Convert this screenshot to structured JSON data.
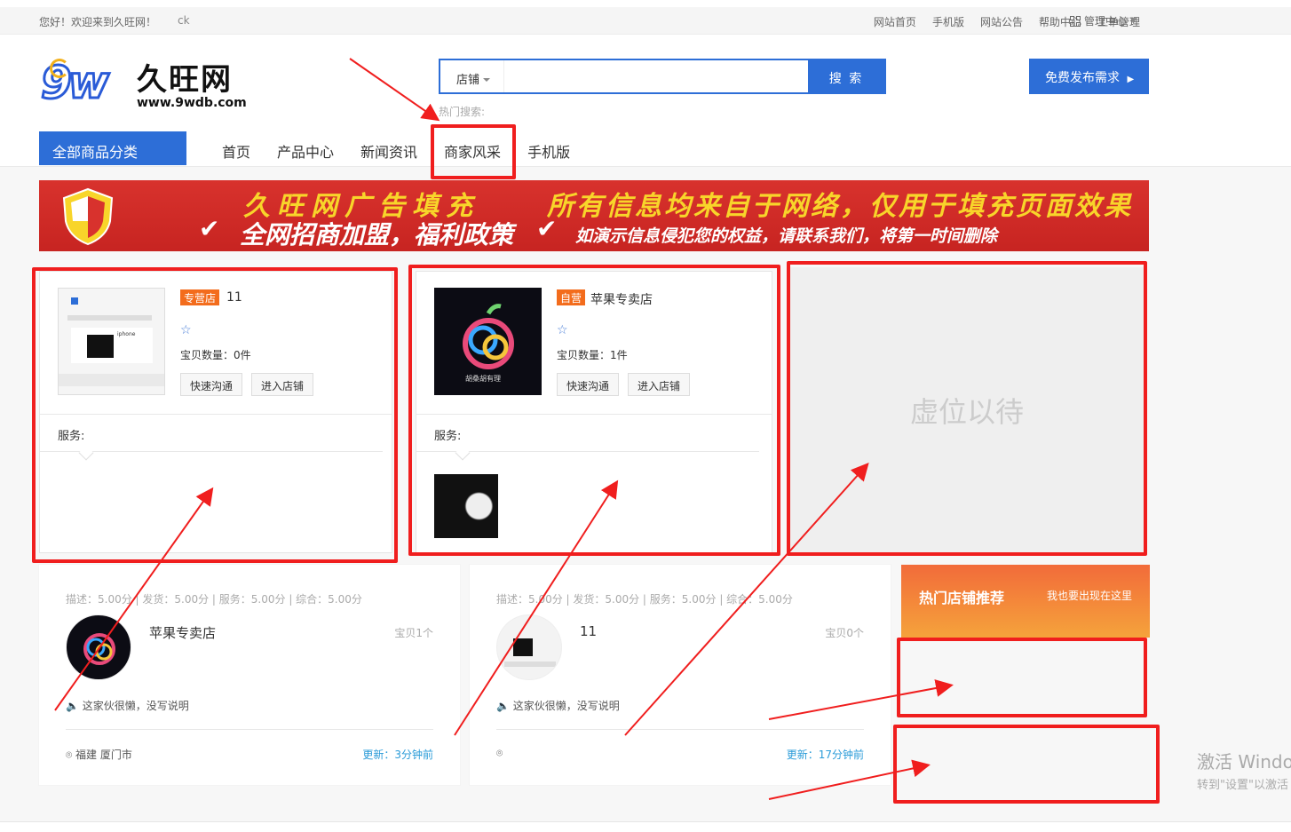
{
  "topbar": {
    "greeting": "您好！欢迎来到久旺网！",
    "username": "ck",
    "links": [
      "网站首页",
      "手机版",
      "网站公告",
      "帮助中心",
      "工单管理"
    ],
    "manage": "管理中心"
  },
  "logo": {
    "mark": "9w",
    "name": "久旺网",
    "url": "www.9wdb.com"
  },
  "search": {
    "type": "店铺",
    "placeholder": "",
    "button": "搜 索",
    "hot_label": "热门搜索:"
  },
  "publish_button": "免费发布需求",
  "nav": {
    "all_categories": "全部商品分类",
    "items": [
      "首页",
      "产品中心",
      "新闻资讯",
      "商家风采",
      "手机版"
    ]
  },
  "banner": {
    "line1": "久旺网广告填充",
    "line2": "全网招商加盟，福利政策",
    "line3": "所有信息均来自于网络，仅用于填充页面效果",
    "line4": "如演示信息侵犯您的权益，请联系我们，将第一时间删除"
  },
  "shops": [
    {
      "badge": "专营店",
      "name": "11",
      "count_label": "宝贝数量：0件",
      "chat_button": "快速沟通",
      "enter_button": "进入店铺",
      "service_label": "服务:",
      "thumb_text": "iphone"
    },
    {
      "badge": "自营",
      "name": "苹果专卖店",
      "count_label": "宝贝数量：1件",
      "chat_button": "快速沟通",
      "enter_button": "进入店铺",
      "service_label": "服务:",
      "thumb_text": "胡桑胡有理"
    }
  ],
  "placeholder_text": "虚位以待",
  "shop_cards": [
    {
      "rates": "描述：5.00分 | 发货：5.00分 | 服务：5.00分 | 综合：5.00分",
      "name": "苹果专卖店",
      "items_prefix": "宝贝",
      "items_count": "1",
      "items_suffix": "个",
      "desc": "这家伙很懒，没写说明",
      "location": "福建 厦门市",
      "updated": "更新：3分钟前"
    },
    {
      "rates": "描述：5.00分 | 发货：5.00分 | 服务：5.00分 | 综合：5.00分",
      "name": "11",
      "items_prefix": "宝贝",
      "items_count": "0",
      "items_suffix": "个",
      "desc": "这家伙很懒，没写说明",
      "location": "",
      "updated": "更新：17分钟前"
    }
  ],
  "hot_shops": {
    "title": "热门店铺推荐",
    "subtitle": "我也要出现在这里"
  },
  "watermark": {
    "line1": "激活 Windo",
    "line2": "转到\"设置\"以激活"
  },
  "colors": {
    "primary": "#2d6ed7",
    "annotation_red": "#f01e1e",
    "badge_orange": "#f36c1c",
    "banner_red": "#d8322d"
  }
}
